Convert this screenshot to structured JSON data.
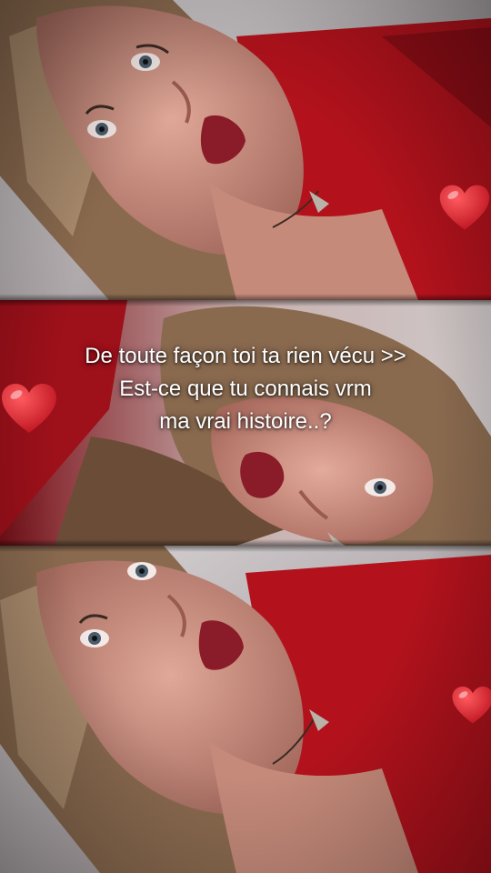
{
  "overlay_text": {
    "line1": "De toute façon toi ta rien vécu >>",
    "line2": "Est-ce que tu connais vrm",
    "line3": "ma vrai histoire..?"
  },
  "panels": [
    {
      "name": "selfie-panel-top",
      "content": "tilted selfie, red top, necklace"
    },
    {
      "name": "selfie-panel-middle",
      "content": "rotated mirrored selfie"
    },
    {
      "name": "selfie-panel-bottom",
      "content": "tilted selfie, red top, necklace"
    }
  ],
  "hearts": [
    "red-heart-emoji",
    "red-heart-emoji",
    "red-heart-emoji"
  ],
  "colors": {
    "top_red": "#b3121c",
    "skin": "#c98f80",
    "hair": "#8a6a4f",
    "lips": "#8a1c2a",
    "heart": "#d91a26",
    "text": "#ffffff"
  }
}
